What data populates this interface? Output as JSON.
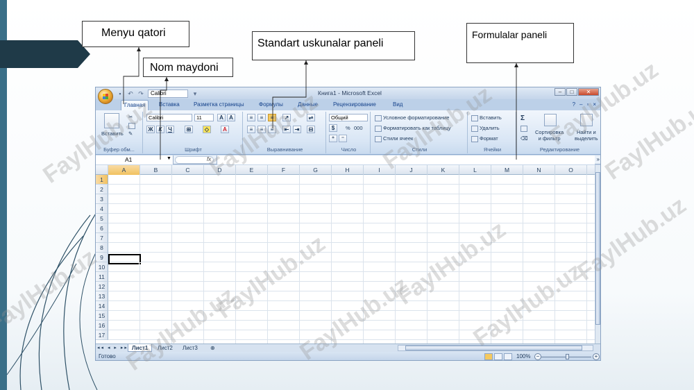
{
  "callouts": {
    "menu": "Menyu qatori",
    "name_box": "Nom maydoni",
    "standard_toolbar": "Standart uskunalar  paneli",
    "formula_bar": "Formulalar paneli"
  },
  "excel": {
    "title": "Книга1 - Microsoft Excel",
    "qat_font": "Calibri",
    "tabs": [
      "Главная",
      "Вставка",
      "Разметка страницы",
      "Формулы",
      "Данные",
      "Рецензирование",
      "Вид"
    ],
    "ribbon": {
      "clipboard": {
        "label": "Буфер обм...",
        "paste": "Вставить"
      },
      "font": {
        "label": "Шрифт",
        "font_name": "Calibri",
        "font_size": "11"
      },
      "alignment": {
        "label": "Выравнивание"
      },
      "number": {
        "label": "Число",
        "format": "Общий",
        "percent": "%",
        "thousands": "000"
      },
      "styles": {
        "label": "Стили",
        "conditional": "Условное форматирование",
        "as_table": "Форматировать как таблицу",
        "cell_styles": "Стили ячеек"
      },
      "cells": {
        "label": "Ячейки",
        "insert": "Вставить",
        "delete": "Удалить",
        "format": "Формат"
      },
      "editing": {
        "label": "Редактирование",
        "sort_line1": "Сортировка",
        "sort_line2": "и фильтр",
        "find_line1": "Найти и",
        "find_line2": "выделить"
      }
    },
    "name_box_value": "A1",
    "fx": "fx",
    "columns": [
      "A",
      "B",
      "C",
      "D",
      "E",
      "F",
      "G",
      "H",
      "I",
      "J",
      "K",
      "L",
      "M",
      "N",
      "O"
    ],
    "rows": [
      "1",
      "2",
      "3",
      "4",
      "5",
      "6",
      "7",
      "8",
      "9",
      "10",
      "11",
      "12",
      "13",
      "14",
      "15",
      "16",
      "17"
    ],
    "sheets": [
      "Лист1",
      "Лист2",
      "Лист3"
    ],
    "status": "Готово",
    "zoom": "100%"
  },
  "watermark": "FaylHub.uz"
}
